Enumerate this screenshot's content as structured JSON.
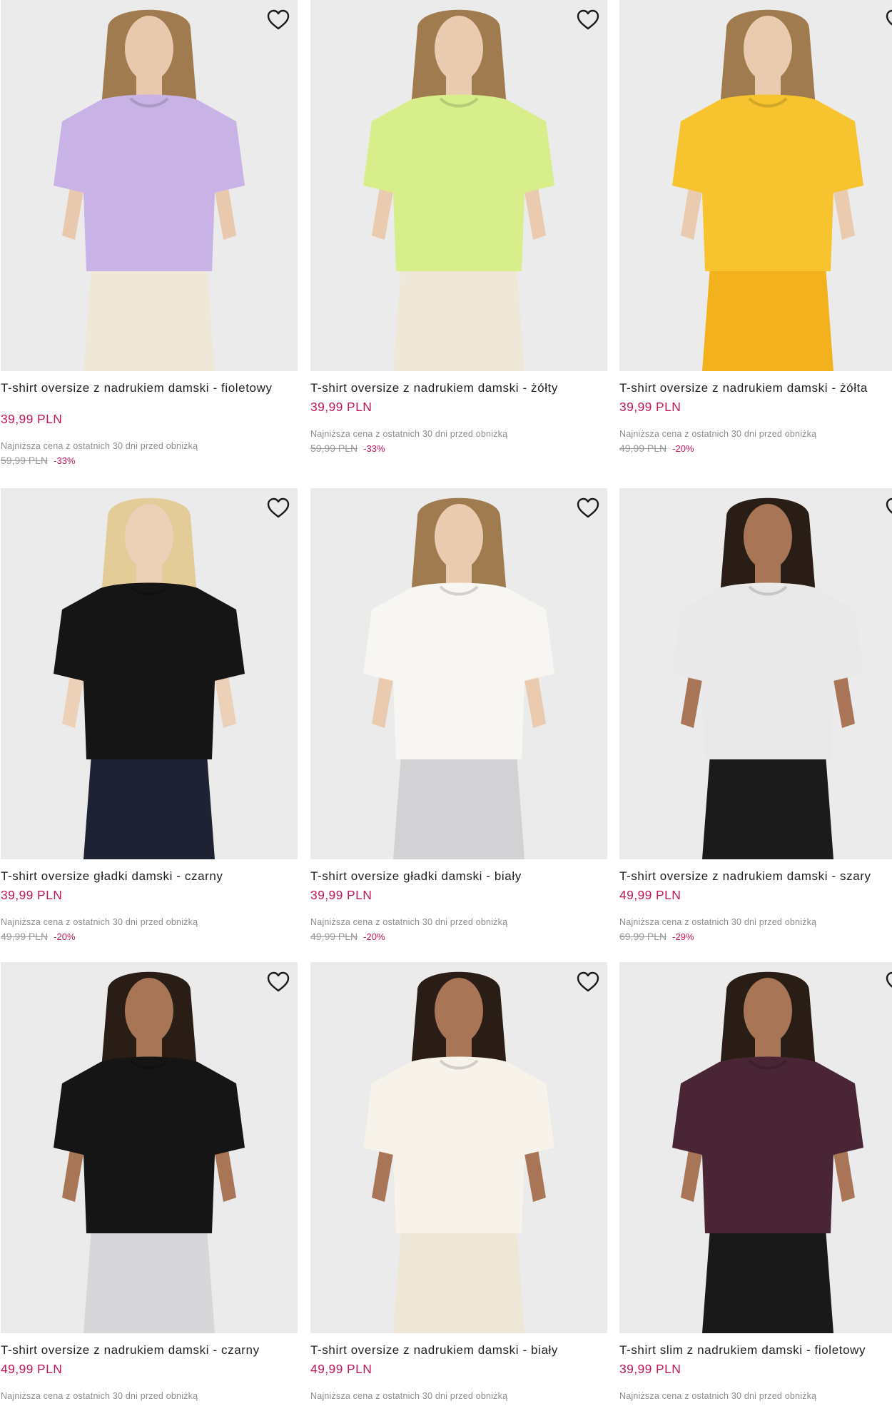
{
  "products": [
    {
      "name": "T-shirt oversize z nadrukiem damski - fioletowy",
      "price": "39,99 PLN",
      "lowest_label": "Najniższa cena z ostatnich 30 dni przed obniżką",
      "old_price": "59,99 PLN",
      "discount": "-33%",
      "shirt_color": "#c9b3e6",
      "bottom_color": "#efe8d8",
      "hair_color": "#a07b4f",
      "skin_color": "#e9c9ae"
    },
    {
      "name": "T-shirt oversize z nadrukiem damski - żółty",
      "price": "39,99 PLN",
      "lowest_label": "Najniższa cena z ostatnich 30 dni przed obniżką",
      "old_price": "59,99 PLN",
      "discount": "-33%",
      "shirt_color": "#d7ee8a",
      "bottom_color": "#efe8d8",
      "hair_color": "#a07b4f",
      "skin_color": "#ebcbb0"
    },
    {
      "name": "T-shirt oversize z nadrukiem damski - żółta",
      "price": "39,99 PLN",
      "lowest_label": "Najniższa cena z ostatnich 30 dni przed obniżką",
      "old_price": "49,99 PLN",
      "discount": "-20%",
      "shirt_color": "#f7c42f",
      "bottom_color": "#f3b11d",
      "hair_color": "#a07b4f",
      "skin_color": "#ebcbb0"
    },
    {
      "name": "T-shirt oversize gładki damski - czarny",
      "price": "39,99 PLN",
      "lowest_label": "Najniższa cena z ostatnich 30 dni przed obniżką",
      "old_price": "49,99 PLN",
      "discount": "-20%",
      "shirt_color": "#151515",
      "bottom_color": "#1e2233",
      "hair_color": "#e4cc98",
      "skin_color": "#ecd0b8"
    },
    {
      "name": "T-shirt oversize gładki damski - biały",
      "price": "39,99 PLN",
      "lowest_label": "Najniższa cena z ostatnich 30 dni przed obniżką",
      "old_price": "49,99 PLN",
      "discount": "-20%",
      "shirt_color": "#f8f6f2",
      "bottom_color": "#d2d2d4",
      "hair_color": "#a07b4f",
      "skin_color": "#ebcbb0"
    },
    {
      "name": "T-shirt oversize z nadrukiem damski - szary",
      "price": "49,99 PLN",
      "lowest_label": "Najniższa cena z ostatnich 30 dni przed obniżką",
      "old_price": "69,99 PLN",
      "discount": "-29%",
      "shirt_color": "#e9e9ea",
      "bottom_color": "#1b1b1b",
      "hair_color": "#2a1d16",
      "skin_color": "#a97557"
    },
    {
      "name": "T-shirt oversize z nadrukiem damski - czarny",
      "price": "49,99 PLN",
      "lowest_label": "Najniższa cena z ostatnich 30 dni przed obniżką",
      "old_price": "",
      "discount": "",
      "shirt_color": "#151515",
      "bottom_color": "#d7d7d9",
      "hair_color": "#2a1d16",
      "skin_color": "#a97557"
    },
    {
      "name": "T-shirt oversize z nadrukiem damski - biały",
      "price": "49,99 PLN",
      "lowest_label": "Najniższa cena z ostatnich 30 dni przed obniżką",
      "old_price": "",
      "discount": "",
      "shirt_color": "#f7f3ea",
      "bottom_color": "#eee7d7",
      "hair_color": "#2a1d16",
      "skin_color": "#a97557"
    },
    {
      "name": "T-shirt slim z nadrukiem damski - fioletowy",
      "price": "39,99 PLN",
      "lowest_label": "Najniższa cena z ostatnich 30 dni przed obniżką",
      "old_price": "",
      "discount": "",
      "shirt_color": "#4a2535",
      "bottom_color": "#191919",
      "hair_color": "#2a1d16",
      "skin_color": "#a97557"
    }
  ],
  "ui": {
    "wishlist_icon": "heart-outline-icon",
    "price_color": "#c2185b",
    "image_background": "#ebebeb"
  }
}
